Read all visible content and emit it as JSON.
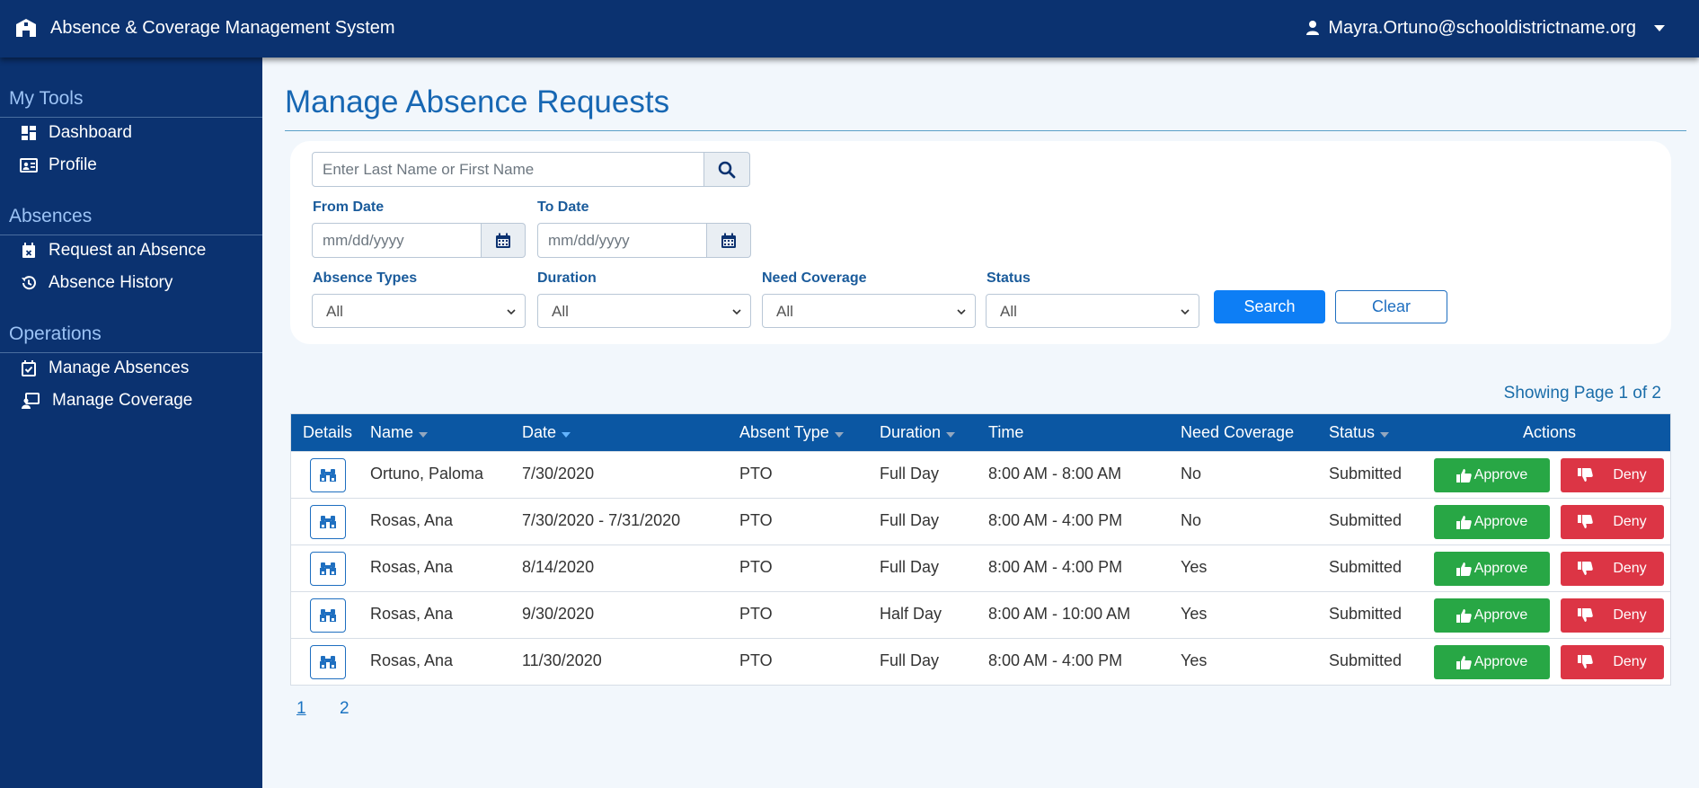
{
  "header": {
    "app_title": "Absence & Coverage Management System",
    "user_email": "Mayra.Ortuno@schooldistrictname.org"
  },
  "sidebar": {
    "sections": [
      {
        "title": "My Tools",
        "items": [
          {
            "label": "Dashboard",
            "icon": "dashboard-icon"
          },
          {
            "label": "Profile",
            "icon": "id-card-icon"
          }
        ]
      },
      {
        "title": "Absences",
        "items": [
          {
            "label": "Request an Absence",
            "icon": "calendar-x-icon"
          },
          {
            "label": "Absence History",
            "icon": "history-icon"
          }
        ]
      },
      {
        "title": "Operations",
        "items": [
          {
            "label": "Manage Absences",
            "icon": "calendar-check-icon"
          },
          {
            "label": "Manage Coverage",
            "icon": "person-board-icon"
          }
        ]
      }
    ]
  },
  "main": {
    "title": "Manage Absence Requests",
    "filters": {
      "search_placeholder": "Enter Last Name or First Name",
      "from_date_label": "From Date",
      "to_date_label": "To Date",
      "date_placeholder": "mm/dd/yyyy",
      "absence_types_label": "Absence Types",
      "absence_types_value": "All",
      "duration_label": "Duration",
      "duration_value": "All",
      "need_coverage_label": "Need Coverage",
      "need_coverage_value": "All",
      "status_label": "Status",
      "status_value": "All",
      "search_button": "Search",
      "clear_button": "Clear"
    },
    "page_info": "Showing Page 1 of 2",
    "table": {
      "columns": {
        "details": "Details",
        "name": "Name",
        "date": "Date",
        "absent_type": "Absent Type",
        "duration": "Duration",
        "time": "Time",
        "need_coverage": "Need Coverage",
        "status": "Status",
        "actions": "Actions"
      },
      "approve_label": "Approve",
      "deny_label": "Deny",
      "rows": [
        {
          "name": "Ortuno, Paloma",
          "date": "7/30/2020",
          "type": "PTO",
          "duration": "Full Day",
          "time": "8:00 AM - 8:00 AM",
          "coverage": "No",
          "status": "Submitted"
        },
        {
          "name": "Rosas, Ana",
          "date": "7/30/2020 - 7/31/2020",
          "type": "PTO",
          "duration": "Full Day",
          "time": "8:00 AM - 4:00 PM",
          "coverage": "No",
          "status": "Submitted"
        },
        {
          "name": "Rosas, Ana",
          "date": "8/14/2020",
          "type": "PTO",
          "duration": "Full Day",
          "time": "8:00 AM - 4:00 PM",
          "coverage": "Yes",
          "status": "Submitted"
        },
        {
          "name": "Rosas, Ana",
          "date": "9/30/2020",
          "type": "PTO",
          "duration": "Half Day",
          "time": "8:00 AM - 10:00 AM",
          "coverage": "Yes",
          "status": "Submitted"
        },
        {
          "name": "Rosas, Ana",
          "date": "11/30/2020",
          "type": "PTO",
          "duration": "Full Day",
          "time": "8:00 AM - 4:00 PM",
          "coverage": "Yes",
          "status": "Submitted"
        }
      ]
    },
    "pagination": [
      "1",
      "2"
    ]
  },
  "colors": {
    "navy": "#0b3270",
    "table_header": "#0b57a3",
    "primary_blue": "#0d7ef5",
    "approve_green": "#28a745",
    "deny_red": "#dc3545"
  }
}
